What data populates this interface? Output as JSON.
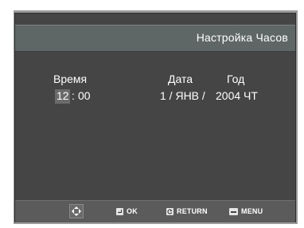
{
  "header": {
    "title": "Настройка Часов"
  },
  "clock": {
    "time_label": "Время",
    "hour": "12",
    "separator": ":",
    "minute": "00",
    "date_label": "Дата",
    "date_value": "1 / ЯНВ /",
    "year_label": "Год",
    "year_value": "2004 ЧТ"
  },
  "footer": {
    "ok_label": "OK",
    "return_label": "RETURN",
    "menu_label": "MENU"
  },
  "icons": {
    "nav": "directional-pad-icon",
    "ok": "enter-icon",
    "return": "return-arrow-icon",
    "menu": "menu-icon"
  }
}
